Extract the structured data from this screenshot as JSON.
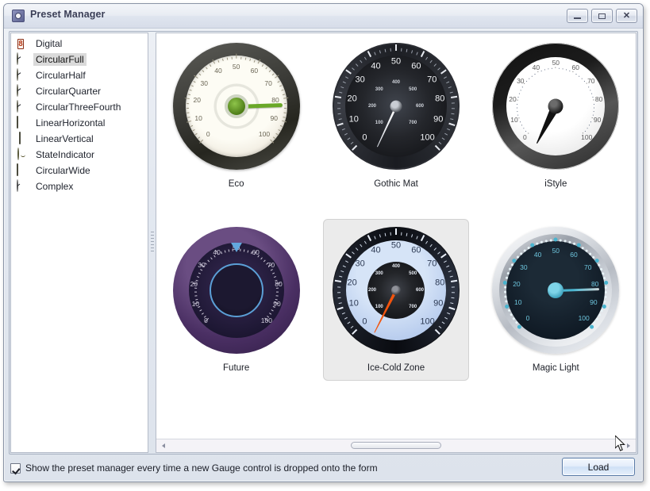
{
  "window": {
    "title": "Preset Manager",
    "icon": "gauge-app-icon",
    "controls": {
      "minimize": "minimize-icon",
      "maximize": "maximize-icon",
      "close": "close-icon"
    }
  },
  "sidebar": {
    "items": [
      {
        "label": "Digital",
        "icon": "digital-gauge-icon",
        "selected": false
      },
      {
        "label": "CircularFull",
        "icon": "circular-full-gauge-icon",
        "selected": true
      },
      {
        "label": "CircularHalf",
        "icon": "circular-half-gauge-icon",
        "selected": false
      },
      {
        "label": "CircularQuarter",
        "icon": "circular-quarter-gauge-icon",
        "selected": false
      },
      {
        "label": "CircularThreeFourth",
        "icon": "circular-three-fourth-icon",
        "selected": false
      },
      {
        "label": "LinearHorizontal",
        "icon": "linear-horizontal-gauge-icon",
        "selected": false
      },
      {
        "label": "LinearVertical",
        "icon": "linear-vertical-gauge-icon",
        "selected": false
      },
      {
        "label": "StateIndicator",
        "icon": "state-indicator-icon",
        "selected": false
      },
      {
        "label": "CircularWide",
        "icon": "circular-wide-gauge-icon",
        "selected": false
      },
      {
        "label": "Complex",
        "icon": "complex-gauge-icon",
        "selected": false
      }
    ]
  },
  "presets": [
    {
      "name": "Eco",
      "selected": false,
      "style": "eco",
      "scale_labels": [
        "0",
        "10",
        "20",
        "30",
        "40",
        "50",
        "60",
        "70",
        "80",
        "90",
        "100"
      ],
      "needle_value": 80,
      "zones": {
        "low": "#7dbf5a",
        "mid": "#f0b93a",
        "high": "#e2704f"
      }
    },
    {
      "name": "Gothic Mat",
      "selected": false,
      "style": "gothic",
      "scale_labels": [
        "0",
        "10",
        "20",
        "30",
        "40",
        "50",
        "60",
        "70",
        "80",
        "90",
        "100"
      ],
      "inner_scale_labels": [
        "100",
        "200",
        "300",
        "400",
        "500",
        "600",
        "700"
      ],
      "needle_value": 2,
      "zones": {
        "low": "#1d1f24",
        "mid": "#33363d",
        "high": "#1a1c21"
      }
    },
    {
      "name": "iStyle",
      "selected": false,
      "style": "istyle",
      "scale_labels": [
        "0",
        "10",
        "20",
        "30",
        "40",
        "50",
        "60",
        "70",
        "80",
        "90",
        "100"
      ],
      "needle_value": 3,
      "zones": {
        "low": "#83c25e",
        "mid": "#f0b93a",
        "high": "#d9453a"
      }
    },
    {
      "name": "Future",
      "selected": false,
      "style": "future",
      "scale_labels": [
        "0",
        "10",
        "20",
        "30",
        "40",
        "50",
        "60",
        "70",
        "80",
        "90",
        "100"
      ],
      "needle_value": 50,
      "zones": {
        "low": "#18a07a",
        "mid": "#e0c169",
        "high": "#c9718f"
      }
    },
    {
      "name": "Ice-Cold Zone",
      "selected": true,
      "style": "ice",
      "scale_labels": [
        "0",
        "10",
        "20",
        "30",
        "40",
        "50",
        "60",
        "70",
        "80",
        "90",
        "100"
      ],
      "inner_scale_labels": [
        "100",
        "200",
        "300",
        "400",
        "500",
        "600",
        "700"
      ],
      "needle_value": 3,
      "zones": {
        "low": "#0b0d12",
        "mid": "#2c3240",
        "high": "#090b10"
      }
    },
    {
      "name": "Magic Light",
      "selected": true,
      "style": "magic",
      "scale_labels": [
        "0",
        "10",
        "20",
        "30",
        "40",
        "50",
        "60",
        "70",
        "80",
        "90",
        "100"
      ],
      "needle_value": 80,
      "zones": {
        "low": "#1fa383",
        "mid": "#d4bb63",
        "high": "#c4718e"
      }
    }
  ],
  "scrollbar": {
    "left_arrow": "arrow-left-icon",
    "right_arrow": "arrow-right-icon",
    "orientation": "horizontal"
  },
  "footer": {
    "load_label": "Load",
    "checkbox_label": "Show the preset manager every time a new Gauge control is dropped onto the form",
    "checkbox_checked": true
  },
  "colors": {
    "window_bg": "#e3e8f0",
    "panel_bg": "#ffffff",
    "selection": "#dadada",
    "accent": "#5a7ba8",
    "selected_card_bg": "#ebebeb"
  }
}
